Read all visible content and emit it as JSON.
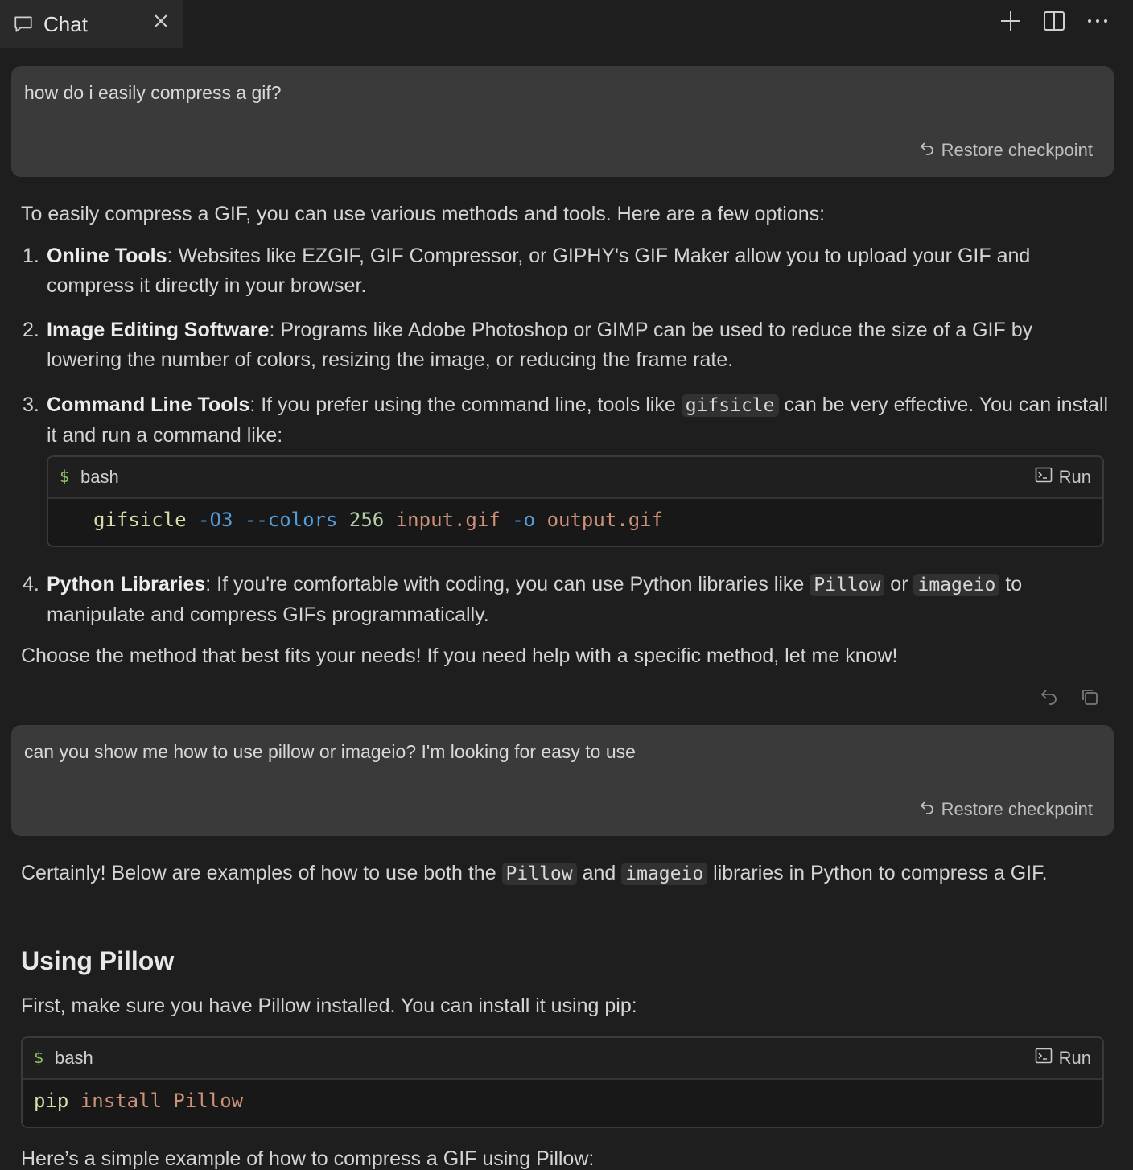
{
  "tab": {
    "label": "Chat"
  },
  "messages": {
    "user1": {
      "text": "how do i easily compress a gif?",
      "restore": "Restore checkpoint"
    },
    "assistant1": {
      "intro": "To easily compress a GIF, you can use various methods and tools. Here are a few options:",
      "items": [
        {
          "num": "1.",
          "title": "Online Tools",
          "text": ": Websites like EZGIF, GIF Compressor, or GIPHY's GIF Maker allow you to upload your GIF and compress it directly in your browser."
        },
        {
          "num": "2.",
          "title": "Image Editing Software",
          "text": ": Programs like Adobe Photoshop or GIMP can be used to reduce the size of a GIF by lowering the number of colors, resizing the image, or reducing the frame rate."
        },
        {
          "num": "3.",
          "title": "Command Line Tools",
          "text_a": ": If you prefer using the command line, tools like ",
          "code": "gifsicle",
          "text_b": " can be very effective. You can install it and run a command like:"
        },
        {
          "num": "4.",
          "title": "Python Libraries",
          "text_a": ": If you're comfortable with coding, you can use Python libraries like ",
          "code1": "Pillow",
          "text_b": " or ",
          "code2": "imageio",
          "text_c": " to manipulate and compress GIFs programmatically."
        }
      ],
      "codeblock": {
        "lang": "bash",
        "run": "Run",
        "tokens": {
          "cmd": "gifsicle",
          "f1": "-O3",
          "f2": "--colors",
          "n": "256",
          "in": "input.gif",
          "f3": "-o",
          "out": "output.gif"
        }
      },
      "outro": "Choose the method that best fits your needs! If you need help with a specific method, let me know!"
    },
    "user2": {
      "text": "can you show me how to use pillow or imageio? I'm looking for easy to use",
      "restore": "Restore checkpoint"
    },
    "assistant2": {
      "p1_a": "Certainly! Below are examples of how to use both the ",
      "p1_code1": "Pillow",
      "p1_b": " and ",
      "p1_code2": "imageio",
      "p1_c": " libraries in Python to compress a GIF.",
      "heading": "Using Pillow",
      "p2": "First, make sure you have Pillow installed. You can install it using pip:",
      "codeblock": {
        "lang": "bash",
        "run": "Run",
        "tokens": {
          "cmd": "pip",
          "a1": "install",
          "a2": "Pillow"
        }
      },
      "p3": "Here’s a simple example of how to compress a GIF using Pillow:"
    }
  }
}
